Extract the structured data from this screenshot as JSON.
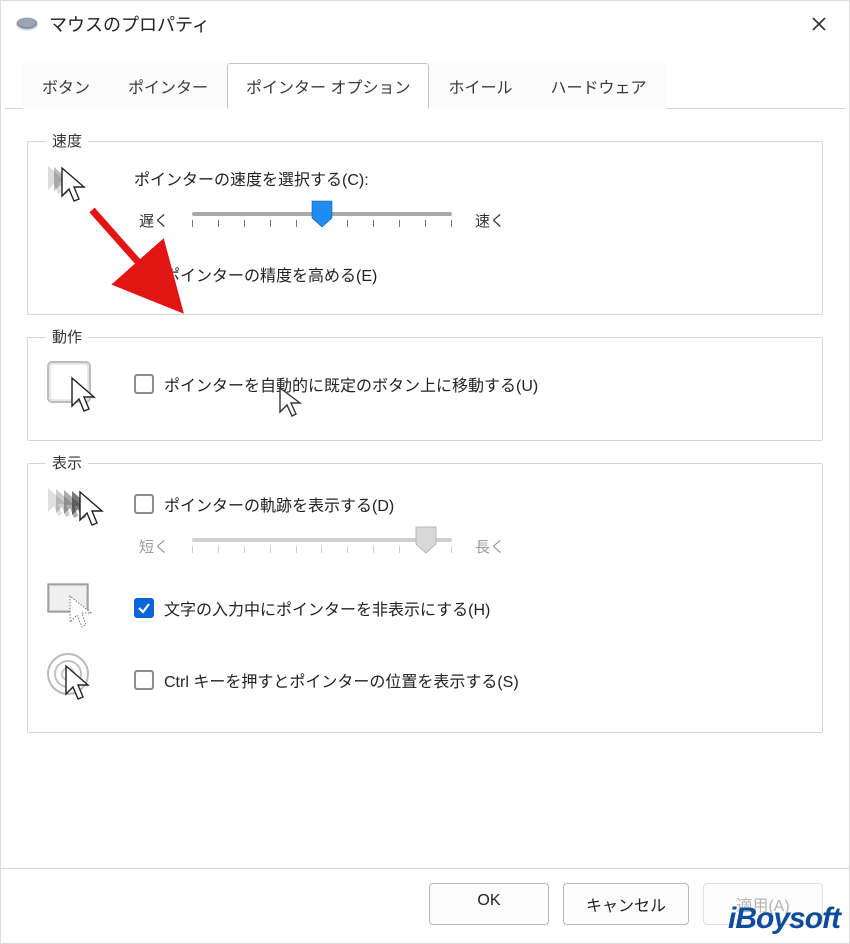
{
  "window": {
    "title": "マウスのプロパティ"
  },
  "tabs": {
    "buttons": "ボタン",
    "pointers": "ポインター",
    "pointer_options": "ポインター オプション",
    "wheel": "ホイール",
    "hardware": "ハードウェア"
  },
  "speed": {
    "legend": "速度",
    "label": "ポインターの速度を選択する(C):",
    "slow": "遅く",
    "fast": "速く",
    "value": 5,
    "max": 10,
    "enhance_precision": {
      "label": "ポインターの精度を高める(E)",
      "checked": true
    }
  },
  "snap": {
    "legend": "動作",
    "auto_move": {
      "label": "ポインターを自動的に既定のボタン上に移動する(U)",
      "checked": false
    }
  },
  "visibility": {
    "legend": "表示",
    "trails": {
      "label": "ポインターの軌跡を表示する(D)",
      "checked": false
    },
    "trails_short": "短く",
    "trails_long": "長く",
    "trails_value": 9,
    "trails_max": 10,
    "hide_typing": {
      "label": "文字の入力中にポインターを非表示にする(H)",
      "checked": true
    },
    "ctrl_locate": {
      "label": "Ctrl キーを押すとポインターの位置を表示する(S)",
      "checked": false
    }
  },
  "buttons": {
    "ok": "OK",
    "cancel": "キャンセル",
    "apply": "適用(A)"
  },
  "watermark": "iBoysoft"
}
